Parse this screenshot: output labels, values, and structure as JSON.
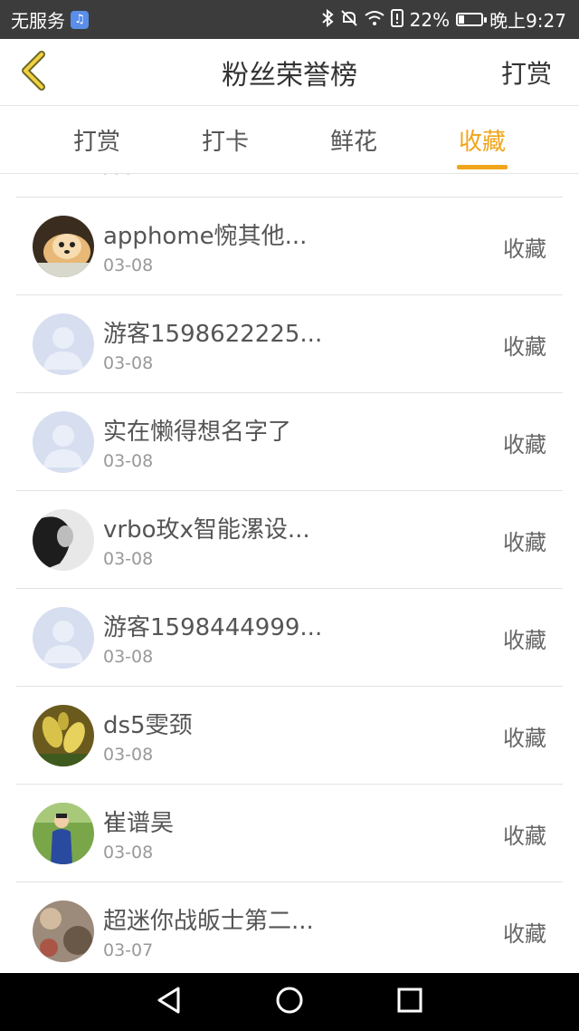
{
  "status_bar": {
    "carrier": "无服务",
    "battery": "22%",
    "battery_level": 0.22,
    "time": "晚上9:27"
  },
  "header": {
    "title": "粉丝荣誉榜",
    "right_action": "打赏"
  },
  "tabs": [
    {
      "label": "打赏",
      "active": false
    },
    {
      "label": "打卡",
      "active": false
    },
    {
      "label": "鲜花",
      "active": false
    },
    {
      "label": "收藏",
      "active": true
    }
  ],
  "list": {
    "items": [
      {
        "name": "apphome惋其他...",
        "date": "03-08",
        "action": "收藏",
        "avatar": "dog-photo"
      },
      {
        "name": "游客1598622225...",
        "date": "03-08",
        "action": "收藏",
        "avatar": "default-user"
      },
      {
        "name": "实在懒得想名字了",
        "date": "03-08",
        "action": "收藏",
        "avatar": "default-user"
      },
      {
        "name": "vrbo玫x智能漯设...",
        "date": "03-08",
        "action": "收藏",
        "avatar": "bw-portrait"
      },
      {
        "name": "游客1598444999...",
        "date": "03-08",
        "action": "收藏",
        "avatar": "default-user"
      },
      {
        "name": "ds5雯颈",
        "date": "03-08",
        "action": "收藏",
        "avatar": "flower-photo"
      },
      {
        "name": "崔谱昊",
        "date": "03-08",
        "action": "收藏",
        "avatar": "boy-photo"
      },
      {
        "name": "超迷你战皈士第二...",
        "date": "03-07",
        "action": "收藏",
        "avatar": "blurry-photo"
      }
    ]
  },
  "colors": {
    "accent": "#f0a51a",
    "status_bar_bg": "#3c3c3c",
    "nav_bar_bg": "#000000"
  }
}
